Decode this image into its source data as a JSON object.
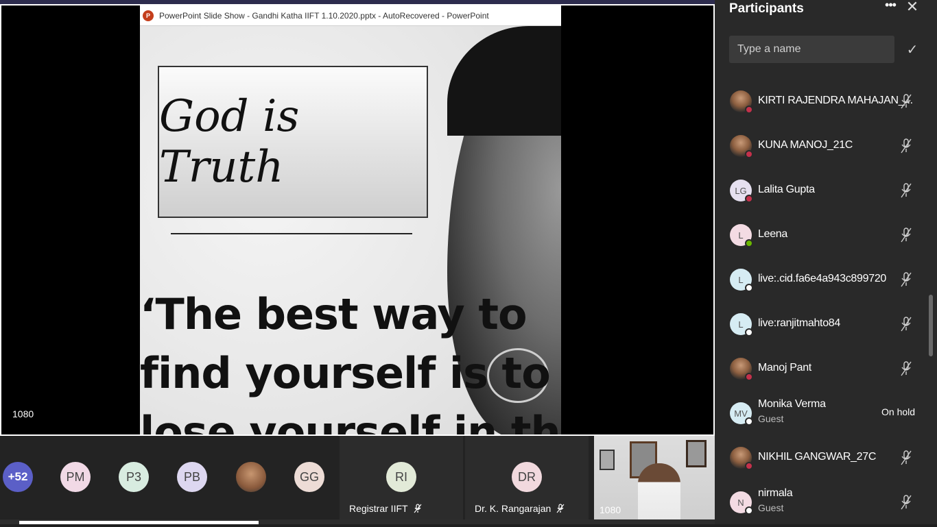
{
  "ppt": {
    "title": "PowerPoint Slide Show  -  Gandhi Katha IIFT 1.10.2020.pptx  -  AutoRecovered - PowerPoint",
    "slide_heading": "God is Truth",
    "slide_quote_lines": [
      "‘The best way to",
      "find yourself is to",
      "lose yourself in the"
    ]
  },
  "share": {
    "resolution_label": "1080"
  },
  "strip": {
    "more_count": "+52",
    "avatars": [
      "PM",
      "P3",
      "PB",
      "GG"
    ],
    "tiles": [
      {
        "initials": "RI",
        "name": "Registrar IIFT"
      },
      {
        "initials": "DR",
        "name": "Dr. K. Rangarajan"
      }
    ],
    "video_resolution_label": "1080"
  },
  "progress": {
    "fraction": 0.27
  },
  "panel": {
    "title": "Participants",
    "search_placeholder": "Type a name",
    "participants": [
      {
        "name": "KIRTI RAJENDRA MAHAJAN_...",
        "initials": "",
        "photo": true,
        "status": "busy",
        "muted": true
      },
      {
        "name": "KUNA MANOJ_21C",
        "initials": "",
        "photo": true,
        "status": "busy",
        "muted": true
      },
      {
        "name": "Lalita Gupta",
        "initials": "LG",
        "avatar_color": "#e6e0f0",
        "status": "busy",
        "muted": true
      },
      {
        "name": "Leena",
        "initials": "L",
        "avatar_color": "#f3dbe3",
        "status": "available",
        "muted": true
      },
      {
        "name": "live:.cid.fa6e4a943c899720",
        "initials": "L",
        "avatar_color": "#d6ecf3",
        "status": "offline",
        "muted": true
      },
      {
        "name": "live:ranjitmahto84",
        "initials": "L",
        "avatar_color": "#d6ecf3",
        "status": "offline",
        "muted": true
      },
      {
        "name": "Manoj Pant",
        "initials": "",
        "photo": true,
        "status": "busy",
        "muted": true
      },
      {
        "name": "Monika Verma",
        "initials": "MV",
        "avatar_color": "#d6ecf3",
        "status": "offline",
        "subtitle": "Guest",
        "hold": "On hold"
      },
      {
        "name": "NIKHIL GANGWAR_27C",
        "initials": "",
        "photo": true,
        "status": "busy",
        "muted": true
      },
      {
        "name": "nirmala",
        "initials": "N",
        "avatar_color": "#f3dbe3",
        "status": "offline",
        "subtitle": "Guest",
        "muted": true
      }
    ]
  },
  "colors": {
    "busy": "#c4314b",
    "available": "#6bb700",
    "offline": "#ffffff",
    "accent": "#5b5fc7"
  }
}
